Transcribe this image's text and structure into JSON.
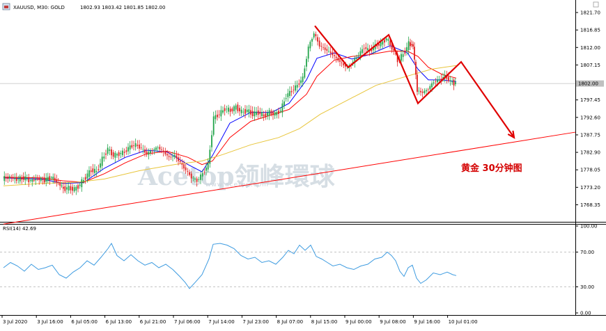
{
  "chart_data": {
    "type": "candlestick",
    "info": {
      "symbol": "XAUUSD, M30:  GOLD",
      "ohlc": "1802.93 1803.42 1801.85 1802.00"
    },
    "price_axis": {
      "ticks": [
        "1821.70",
        "1816.85",
        "1812.00",
        "1807.15",
        "1802.00",
        "1797.45",
        "1792.60",
        "1787.75",
        "1782.90",
        "1778.05",
        "1773.20",
        "1768.35"
      ],
      "tick_values": [
        1821.7,
        1816.85,
        1812.0,
        1807.15,
        1802.0,
        1797.45,
        1792.6,
        1787.75,
        1782.9,
        1778.05,
        1773.2,
        1768.35
      ],
      "current_price": "1802.00",
      "ylim": [
        1765.5,
        1824.5
      ]
    },
    "time_axis": {
      "labels": [
        "3 Jul 2020",
        "3 Jul 16:00",
        "6 Jul 05:00",
        "6 Jul 13:00",
        "6 Jul 21:00",
        "7 Jul 06:00",
        "7 Jul 14:00",
        "7 Jul 23:00",
        "8 Jul 07:00",
        "8 Jul 15:00",
        "9 Jul 00:00",
        "9 Jul 08:00",
        "9 Jul 16:00",
        "10 Jul 01:00"
      ]
    },
    "price_series": [
      {
        "x": 5,
        "v": 1775.6
      },
      {
        "x": 15,
        "v": 1776.0
      },
      {
        "x": 25,
        "v": 1775.4
      },
      {
        "x": 35,
        "v": 1775.8
      },
      {
        "x": 45,
        "v": 1775.0
      },
      {
        "x": 55,
        "v": 1775.5
      },
      {
        "x": 65,
        "v": 1775.2
      },
      {
        "x": 75,
        "v": 1776.0
      },
      {
        "x": 85,
        "v": 1774.4
      },
      {
        "x": 92,
        "v": 1772.8
      },
      {
        "x": 100,
        "v": 1773.0
      },
      {
        "x": 108,
        "v": 1772.6
      },
      {
        "x": 116,
        "v": 1774.0
      },
      {
        "x": 124,
        "v": 1776.0
      },
      {
        "x": 132,
        "v": 1778.0
      },
      {
        "x": 140,
        "v": 1777.5
      },
      {
        "x": 148,
        "v": 1781.0
      },
      {
        "x": 156,
        "v": 1783.8
      },
      {
        "x": 164,
        "v": 1782.0
      },
      {
        "x": 172,
        "v": 1782.5
      },
      {
        "x": 180,
        "v": 1783.0
      },
      {
        "x": 188,
        "v": 1784.5
      },
      {
        "x": 196,
        "v": 1785.0
      },
      {
        "x": 204,
        "v": 1784.0
      },
      {
        "x": 212,
        "v": 1782.5
      },
      {
        "x": 220,
        "v": 1783.5
      },
      {
        "x": 228,
        "v": 1784.3
      },
      {
        "x": 236,
        "v": 1783.0
      },
      {
        "x": 244,
        "v": 1781.5
      },
      {
        "x": 252,
        "v": 1782.0
      },
      {
        "x": 260,
        "v": 1780.0
      },
      {
        "x": 268,
        "v": 1778.0
      },
      {
        "x": 276,
        "v": 1776.0
      },
      {
        "x": 284,
        "v": 1775.0
      },
      {
        "x": 292,
        "v": 1777.0
      },
      {
        "x": 300,
        "v": 1779.5
      },
      {
        "x": 308,
        "v": 1792.5
      },
      {
        "x": 316,
        "v": 1793.5
      },
      {
        "x": 324,
        "v": 1795.0
      },
      {
        "x": 332,
        "v": 1794.5
      },
      {
        "x": 340,
        "v": 1795.5
      },
      {
        "x": 348,
        "v": 1794.0
      },
      {
        "x": 356,
        "v": 1794.5
      },
      {
        "x": 364,
        "v": 1793.5
      },
      {
        "x": 372,
        "v": 1794.0
      },
      {
        "x": 380,
        "v": 1793.0
      },
      {
        "x": 388,
        "v": 1794.0
      },
      {
        "x": 396,
        "v": 1793.5
      },
      {
        "x": 404,
        "v": 1794.5
      },
      {
        "x": 412,
        "v": 1798.5
      },
      {
        "x": 420,
        "v": 1800.0
      },
      {
        "x": 428,
        "v": 1801.5
      },
      {
        "x": 436,
        "v": 1803.5
      },
      {
        "x": 444,
        "v": 1812.0
      },
      {
        "x": 452,
        "v": 1816.0
      },
      {
        "x": 460,
        "v": 1812.5
      },
      {
        "x": 468,
        "v": 1811.5
      },
      {
        "x": 476,
        "v": 1810.5
      },
      {
        "x": 484,
        "v": 1809.0
      },
      {
        "x": 492,
        "v": 1807.5
      },
      {
        "x": 500,
        "v": 1806.5
      },
      {
        "x": 508,
        "v": 1808.0
      },
      {
        "x": 516,
        "v": 1810.0
      },
      {
        "x": 524,
        "v": 1812.0
      },
      {
        "x": 532,
        "v": 1811.0
      },
      {
        "x": 540,
        "v": 1812.5
      },
      {
        "x": 548,
        "v": 1813.0
      },
      {
        "x": 556,
        "v": 1814.5
      },
      {
        "x": 564,
        "v": 1812.0
      },
      {
        "x": 572,
        "v": 1808.5
      },
      {
        "x": 580,
        "v": 1810.0
      },
      {
        "x": 588,
        "v": 1813.0
      },
      {
        "x": 594,
        "v": 1812.5
      },
      {
        "x": 600,
        "v": 1800.0
      },
      {
        "x": 608,
        "v": 1799.5
      },
      {
        "x": 616,
        "v": 1800.5
      },
      {
        "x": 624,
        "v": 1802.5
      },
      {
        "x": 632,
        "v": 1803.0
      },
      {
        "x": 640,
        "v": 1804.0
      },
      {
        "x": 648,
        "v": 1802.5
      },
      {
        "x": 655,
        "v": 1802.0
      }
    ],
    "moving_averages": [
      {
        "color": "#0000ff",
        "points": [
          [
            5,
            1775.8
          ],
          [
            60,
            1775.5
          ],
          [
            90,
            1774.3
          ],
          [
            120,
            1774.5
          ],
          [
            150,
            1778.5
          ],
          [
            180,
            1781.5
          ],
          [
            210,
            1783.5
          ],
          [
            240,
            1783.0
          ],
          [
            270,
            1779.5
          ],
          [
            290,
            1777.5
          ],
          [
            305,
            1782.0
          ],
          [
            330,
            1791.0
          ],
          [
            360,
            1794.0
          ],
          [
            390,
            1794.0
          ],
          [
            415,
            1796.5
          ],
          [
            440,
            1803.0
          ],
          [
            455,
            1809.0
          ],
          [
            480,
            1810.5
          ],
          [
            505,
            1808.8
          ],
          [
            530,
            1810.0
          ],
          [
            560,
            1812.5
          ],
          [
            585,
            1810.5
          ],
          [
            600,
            1806.0
          ],
          [
            615,
            1803.0
          ],
          [
            635,
            1803.0
          ],
          [
            655,
            1802.5
          ]
        ]
      },
      {
        "color": "#ff0000",
        "points": [
          [
            5,
            1776.0
          ],
          [
            60,
            1775.8
          ],
          [
            90,
            1775.0
          ],
          [
            120,
            1774.6
          ],
          [
            150,
            1777.0
          ],
          [
            180,
            1780.0
          ],
          [
            210,
            1782.5
          ],
          [
            240,
            1783.2
          ],
          [
            270,
            1781.5
          ],
          [
            290,
            1779.5
          ],
          [
            305,
            1780.5
          ],
          [
            330,
            1787.0
          ],
          [
            360,
            1791.5
          ],
          [
            390,
            1793.3
          ],
          [
            415,
            1794.8
          ],
          [
            440,
            1799.0
          ],
          [
            455,
            1804.0
          ],
          [
            480,
            1808.5
          ],
          [
            505,
            1809.5
          ],
          [
            530,
            1810.0
          ],
          [
            560,
            1811.0
          ],
          [
            585,
            1811.0
          ],
          [
            600,
            1809.5
          ],
          [
            615,
            1806.5
          ],
          [
            635,
            1804.5
          ],
          [
            655,
            1803.5
          ]
        ]
      },
      {
        "color": "#e8c53a",
        "points": [
          [
            5,
            1773.6
          ],
          [
            60,
            1774.3
          ],
          [
            110,
            1774.6
          ],
          [
            150,
            1775.5
          ],
          [
            200,
            1777.8
          ],
          [
            250,
            1779.5
          ],
          [
            290,
            1780.5
          ],
          [
            320,
            1782.3
          ],
          [
            360,
            1785.0
          ],
          [
            400,
            1787.0
          ],
          [
            430,
            1789.5
          ],
          [
            460,
            1793.5
          ],
          [
            500,
            1797.5
          ],
          [
            540,
            1801.5
          ],
          [
            580,
            1803.8
          ],
          [
            620,
            1806.0
          ],
          [
            655,
            1807.0
          ]
        ]
      }
    ],
    "trendline": {
      "color": "#ff0000",
      "from": [
        5,
        1763.0
      ],
      "to": [
        826,
        1788.5
      ]
    },
    "pattern_path": {
      "color": "#e00000",
      "points": [
        [
          452,
          1818.0
        ],
        [
          500,
          1806.5
        ],
        [
          558,
          1815.5
        ],
        [
          600,
          1796.5
        ],
        [
          662,
          1808.0
        ],
        [
          738,
          1787.0
        ]
      ]
    },
    "annotation": "黄金 30分钟图",
    "watermark": {
      "text": "Acetop领峰環球",
      "url": "www.acetop.com"
    },
    "rsi": {
      "label": "RSI(14) 42.69",
      "ticks": [
        "100.00",
        "70.00",
        "30.00",
        "0.00"
      ],
      "tick_values": [
        100,
        70,
        30,
        0
      ],
      "levels": [
        70,
        30
      ],
      "color": "#3d9be0",
      "values": [
        [
          5,
          52
        ],
        [
          15,
          58
        ],
        [
          25,
          54
        ],
        [
          35,
          48
        ],
        [
          45,
          56
        ],
        [
          55,
          50
        ],
        [
          65,
          52
        ],
        [
          75,
          55
        ],
        [
          85,
          44
        ],
        [
          95,
          40
        ],
        [
          105,
          47
        ],
        [
          115,
          52
        ],
        [
          125,
          60
        ],
        [
          135,
          55
        ],
        [
          145,
          64
        ],
        [
          155,
          74
        ],
        [
          160,
          80
        ],
        [
          168,
          66
        ],
        [
          178,
          60
        ],
        [
          188,
          67
        ],
        [
          198,
          60
        ],
        [
          208,
          55
        ],
        [
          218,
          58
        ],
        [
          228,
          52
        ],
        [
          238,
          56
        ],
        [
          248,
          50
        ],
        [
          258,
          42
        ],
        [
          266,
          35
        ],
        [
          272,
          28
        ],
        [
          280,
          35
        ],
        [
          290,
          44
        ],
        [
          300,
          62
        ],
        [
          306,
          79
        ],
        [
          316,
          80
        ],
        [
          326,
          78
        ],
        [
          336,
          74
        ],
        [
          346,
          66
        ],
        [
          356,
          62
        ],
        [
          366,
          64
        ],
        [
          376,
          58
        ],
        [
          386,
          60
        ],
        [
          396,
          56
        ],
        [
          406,
          64
        ],
        [
          414,
          72
        ],
        [
          422,
          68
        ],
        [
          430,
          78
        ],
        [
          438,
          72
        ],
        [
          446,
          78
        ],
        [
          454,
          65
        ],
        [
          462,
          62
        ],
        [
          470,
          58
        ],
        [
          478,
          54
        ],
        [
          488,
          56
        ],
        [
          498,
          52
        ],
        [
          508,
          50
        ],
        [
          518,
          54
        ],
        [
          528,
          56
        ],
        [
          538,
          62
        ],
        [
          548,
          64
        ],
        [
          556,
          70
        ],
        [
          562,
          66
        ],
        [
          568,
          60
        ],
        [
          574,
          48
        ],
        [
          580,
          42
        ],
        [
          586,
          52
        ],
        [
          592,
          55
        ],
        [
          598,
          40
        ],
        [
          604,
          34
        ],
        [
          612,
          38
        ],
        [
          622,
          46
        ],
        [
          632,
          44
        ],
        [
          642,
          47
        ],
        [
          650,
          44
        ],
        [
          655,
          43
        ]
      ]
    }
  }
}
